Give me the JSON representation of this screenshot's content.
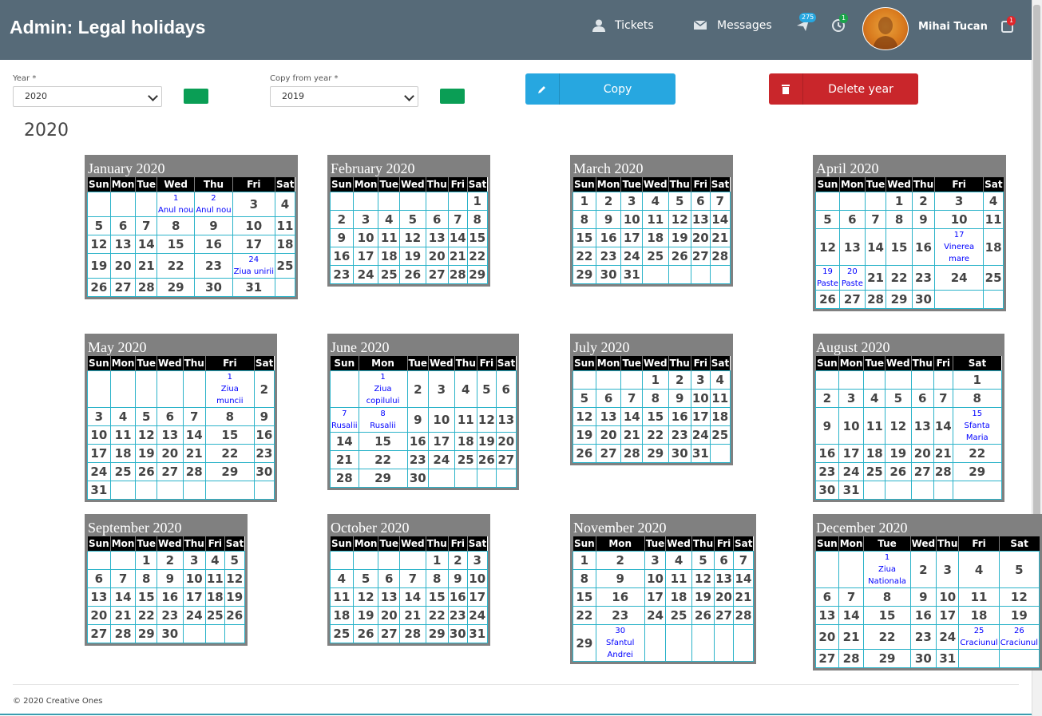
{
  "header": {
    "title": "Admin: Legal holidays",
    "nav_tickets": "Tickets",
    "nav_messages": "Messages",
    "notif_count": "275",
    "history_count": "1",
    "cart_count": "1",
    "user_name": "Mihai Tucan",
    "bar_color": "#566a78"
  },
  "form": {
    "year_label": "Year *",
    "year_value": "2020",
    "copy_from_label": "Copy from year *",
    "copy_from_value": "2019",
    "copy_button": "Copy",
    "delete_button": "Delete year",
    "copy_color": "#27a7e0",
    "delete_color": "#c9262b",
    "green_color": "#0a9e55"
  },
  "year_heading": "2020",
  "weekday_headers": [
    "Sun",
    "Mon",
    "Tue",
    "Wed",
    "Thu",
    "Fri",
    "Sat"
  ],
  "months": [
    {
      "title": "January 2020",
      "weeks": [
        [
          "",
          "",
          "",
          {
            "d": "1",
            "name": "Anul nou"
          },
          {
            "d": "2",
            "name": "Anul nou"
          },
          "3",
          "4"
        ],
        [
          "5",
          "6",
          "7",
          "8",
          "9",
          "10",
          "11"
        ],
        [
          "12",
          "13",
          "14",
          "15",
          "16",
          "17",
          "18"
        ],
        [
          "19",
          "20",
          "21",
          "22",
          "23",
          {
            "d": "24",
            "name": "Ziua unirii"
          },
          "25"
        ],
        [
          "26",
          "27",
          "28",
          "29",
          "30",
          "31",
          ""
        ]
      ]
    },
    {
      "title": "February 2020",
      "weeks": [
        [
          "",
          "",
          "",
          "",
          "",
          "",
          "1"
        ],
        [
          "2",
          "3",
          "4",
          "5",
          "6",
          "7",
          "8"
        ],
        [
          "9",
          "10",
          "11",
          "12",
          "13",
          "14",
          "15"
        ],
        [
          "16",
          "17",
          "18",
          "19",
          "20",
          "21",
          "22"
        ],
        [
          "23",
          "24",
          "25",
          "26",
          "27",
          "28",
          "29"
        ]
      ]
    },
    {
      "title": "March 2020",
      "weeks": [
        [
          "1",
          "2",
          "3",
          "4",
          "5",
          "6",
          "7"
        ],
        [
          "8",
          "9",
          "10",
          "11",
          "12",
          "13",
          "14"
        ],
        [
          "15",
          "16",
          "17",
          "18",
          "19",
          "20",
          "21"
        ],
        [
          "22",
          "23",
          "24",
          "25",
          "26",
          "27",
          "28"
        ],
        [
          "29",
          "30",
          "31",
          "",
          "",
          "",
          ""
        ]
      ]
    },
    {
      "title": "April 2020",
      "weeks": [
        [
          "",
          "",
          "",
          "1",
          "2",
          "3",
          "4"
        ],
        [
          "5",
          "6",
          "7",
          "8",
          "9",
          "10",
          "11"
        ],
        [
          "12",
          "13",
          "14",
          "15",
          "16",
          {
            "d": "17",
            "name": "Vinerea mare"
          },
          "18"
        ],
        [
          {
            "d": "19",
            "name": "Paste"
          },
          {
            "d": "20",
            "name": "Paste"
          },
          "21",
          "22",
          "23",
          "24",
          "25"
        ],
        [
          "26",
          "27",
          "28",
          "29",
          "30",
          "",
          ""
        ]
      ]
    },
    {
      "title": "May 2020",
      "weeks": [
        [
          "",
          "",
          "",
          "",
          "",
          {
            "d": "1",
            "name": "Ziua muncii"
          },
          "2"
        ],
        [
          "3",
          "4",
          "5",
          "6",
          "7",
          "8",
          "9"
        ],
        [
          "10",
          "11",
          "12",
          "13",
          "14",
          "15",
          "16"
        ],
        [
          "17",
          "18",
          "19",
          "20",
          "21",
          "22",
          "23"
        ],
        [
          "24",
          "25",
          "26",
          "27",
          "28",
          "29",
          "30"
        ],
        [
          "31",
          "",
          "",
          "",
          "",
          "",
          ""
        ]
      ]
    },
    {
      "title": "June 2020",
      "weeks": [
        [
          "",
          {
            "d": "1",
            "name": "Ziua copilului"
          },
          "2",
          "3",
          "4",
          "5",
          "6"
        ],
        [
          {
            "d": "7",
            "name": "Rusalii"
          },
          {
            "d": "8",
            "name": "Rusalii"
          },
          "9",
          "10",
          "11",
          "12",
          "13"
        ],
        [
          "14",
          "15",
          "16",
          "17",
          "18",
          "19",
          "20"
        ],
        [
          "21",
          "22",
          "23",
          "24",
          "25",
          "26",
          "27"
        ],
        [
          "28",
          "29",
          "30",
          "",
          "",
          "",
          ""
        ]
      ]
    },
    {
      "title": "July 2020",
      "weeks": [
        [
          "",
          "",
          "",
          "1",
          "2",
          "3",
          "4"
        ],
        [
          "5",
          "6",
          "7",
          "8",
          "9",
          "10",
          "11"
        ],
        [
          "12",
          "13",
          "14",
          "15",
          "16",
          "17",
          "18"
        ],
        [
          "19",
          "20",
          "21",
          "22",
          "23",
          "24",
          "25"
        ],
        [
          "26",
          "27",
          "28",
          "29",
          "30",
          "31",
          ""
        ]
      ]
    },
    {
      "title": "August 2020",
      "weeks": [
        [
          "",
          "",
          "",
          "",
          "",
          "",
          "1"
        ],
        [
          "2",
          "3",
          "4",
          "5",
          "6",
          "7",
          "8"
        ],
        [
          "9",
          "10",
          "11",
          "12",
          "13",
          "14",
          {
            "d": "15",
            "name": "Sfanta Maria"
          }
        ],
        [
          "16",
          "17",
          "18",
          "19",
          "20",
          "21",
          "22"
        ],
        [
          "23",
          "24",
          "25",
          "26",
          "27",
          "28",
          "29"
        ],
        [
          "30",
          "31",
          "",
          "",
          "",
          "",
          ""
        ]
      ]
    },
    {
      "title": "September 2020",
      "weeks": [
        [
          "",
          "",
          "1",
          "2",
          "3",
          "4",
          "5"
        ],
        [
          "6",
          "7",
          "8",
          "9",
          "10",
          "11",
          "12"
        ],
        [
          "13",
          "14",
          "15",
          "16",
          "17",
          "18",
          "19"
        ],
        [
          "20",
          "21",
          "22",
          "23",
          "24",
          "25",
          "26"
        ],
        [
          "27",
          "28",
          "29",
          "30",
          "",
          "",
          ""
        ]
      ]
    },
    {
      "title": "October 2020",
      "weeks": [
        [
          "",
          "",
          "",
          "",
          "1",
          "2",
          "3"
        ],
        [
          "4",
          "5",
          "6",
          "7",
          "8",
          "9",
          "10"
        ],
        [
          "11",
          "12",
          "13",
          "14",
          "15",
          "16",
          "17"
        ],
        [
          "18",
          "19",
          "20",
          "21",
          "22",
          "23",
          "24"
        ],
        [
          "25",
          "26",
          "27",
          "28",
          "29",
          "30",
          "31"
        ]
      ]
    },
    {
      "title": "November 2020",
      "weeks": [
        [
          "1",
          "2",
          "3",
          "4",
          "5",
          "6",
          "7"
        ],
        [
          "8",
          "9",
          "10",
          "11",
          "12",
          "13",
          "14"
        ],
        [
          "15",
          "16",
          "17",
          "18",
          "19",
          "20",
          "21"
        ],
        [
          "22",
          "23",
          "24",
          "25",
          "26",
          "27",
          "28"
        ],
        [
          "29",
          {
            "d": "30",
            "name": "Sfantul Andrei"
          },
          "",
          "",
          "",
          "",
          ""
        ]
      ]
    },
    {
      "title": "December 2020",
      "weeks": [
        [
          "",
          "",
          {
            "d": "1",
            "name": "Ziua Nationala"
          },
          "2",
          "3",
          "4",
          "5"
        ],
        [
          "6",
          "7",
          "8",
          "9",
          "10",
          "11",
          "12"
        ],
        [
          "13",
          "14",
          "15",
          "16",
          "17",
          "18",
          "19"
        ],
        [
          "20",
          "21",
          "22",
          "23",
          "24",
          {
            "d": "25",
            "name": "Craciunul"
          },
          {
            "d": "26",
            "name": "Craciunul"
          }
        ],
        [
          "27",
          "28",
          "29",
          "30",
          "31",
          "",
          ""
        ]
      ]
    }
  ],
  "footer": "© 2020 Creative Ones"
}
